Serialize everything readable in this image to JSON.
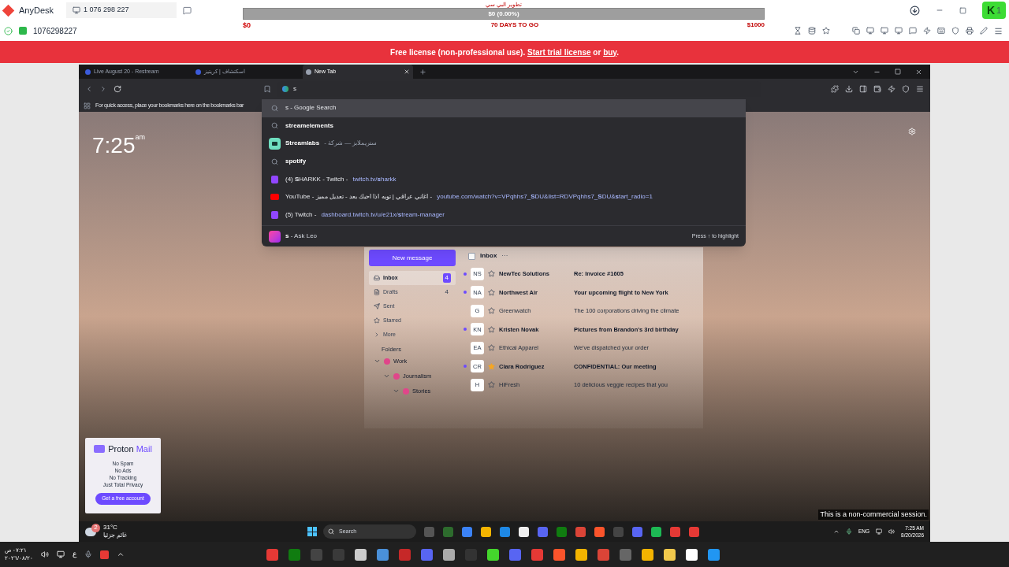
{
  "anydesk": {
    "app_name": "AnyDesk",
    "address": "1 076 298 227",
    "connection_id": "1076298227",
    "logo_letter": "K",
    "logo_badge": "1"
  },
  "goal": {
    "title": "تطوير البي سي",
    "progress": "$0 (0.00%)",
    "level": 0,
    "start": "$0",
    "days": "70 DAYS TO GO",
    "target": "$1000"
  },
  "banner": {
    "prefix": "Free license (non-professional use). ",
    "link_1": "Start trial license",
    "middle": " or ",
    "link_2": "buy",
    "suffix": "."
  },
  "browser": {
    "tabs": [
      {
        "title": "Live August 20 - Restream",
        "selected": false
      },
      {
        "title": "اسكتشاف | كريتيز",
        "selected": false
      },
      {
        "title": "New Tab",
        "selected": true
      }
    ],
    "address": "s",
    "bookmarks_hint": "For quick access, place your bookmarks here on the bookmarks bar",
    "suggestions": [
      {
        "kind": "search",
        "title": "s - Google Search",
        "bold": false,
        "selected": true
      },
      {
        "kind": "search",
        "title": "streamelements",
        "bold": true,
        "selected": false
      },
      {
        "kind": "streamlabs",
        "title": "Streamlabs",
        "bold": true,
        "description": "- ستريملابز — شركة",
        "selected": false
      },
      {
        "kind": "search",
        "title": "spotify",
        "bold": true,
        "selected": false
      },
      {
        "kind": "twitch",
        "title": "(4) **S**HARKK - Twitch -",
        "bold": false,
        "url": "twitch.tv/**s**harkk",
        "selected": false
      },
      {
        "kind": "youtube",
        "title": "YouTube - اغاني عراقي | توبه اذا احبك بعد - تعديل مميز -",
        "bold": false,
        "url": "youtube.com/watch?v=VPqhhs7_**S**DU&list=RDVPqhhs7_**S**DU&**s**tart_radio=1",
        "selected": false
      },
      {
        "kind": "twitch",
        "title": "(5) Twitch -",
        "bold": false,
        "url": "dashboard.twitch.tv/u/e21x/**s**tream-manager",
        "selected": false
      }
    ],
    "ask": {
      "query": "s",
      "label": " - Ask Leo",
      "hint": "Press ↑ to highlight"
    }
  },
  "new_tab": {
    "clock": "7:25",
    "ampm": "am"
  },
  "mail": {
    "new_message": "New message",
    "list_title": "Inbox",
    "select_all_checked": false,
    "more": "···",
    "nav": [
      {
        "kind": "inbox",
        "label": "Inbox",
        "count": "4",
        "selected": true
      },
      {
        "kind": "drafts",
        "label": "Drafts",
        "count": "4",
        "selected": false
      },
      {
        "kind": "sent",
        "label": "Sent",
        "selected": false
      },
      {
        "kind": "starred",
        "label": "Starred",
        "selected": false
      },
      {
        "kind": "more",
        "label": "More",
        "selected": false
      }
    ],
    "folders_label": "Folders",
    "folders": [
      {
        "name": "Work",
        "color": "#e0468a",
        "children": [
          {
            "name": "Journalism",
            "color": "#e0468a",
            "children": [
              {
                "name": "Stories",
                "color": "#e0468a"
              }
            ]
          }
        ]
      }
    ],
    "emails": [
      {
        "initials": "NS",
        "sender": "NewTec Solutions",
        "subject": "Re: Invoice #1605",
        "unread": true,
        "starred": false
      },
      {
        "initials": "NA",
        "sender": "Northwest Air",
        "subject": "Your upcoming flight to New York",
        "unread": true,
        "starred": false
      },
      {
        "initials": "G",
        "sender": "Greenwatch",
        "subject": "The 100 corporations driving the climate",
        "unread": false,
        "starred": false
      },
      {
        "initials": "KN",
        "sender": "Kristen Novak",
        "subject": "Pictures from Brandon's 3rd birthday",
        "unread": true,
        "starred": false
      },
      {
        "initials": "EA",
        "sender": "Ethical Apparel",
        "subject": "We've dispatched your order",
        "unread": false,
        "starred": false
      },
      {
        "initials": "CR",
        "sender": "Clara Rodriguez",
        "subject": "CONFIDENTIAL: Our meeting",
        "unread": true,
        "starred": true
      },
      {
        "initials": "H",
        "sender": "HiFresh",
        "subject": "10 delicious veggie recipes that you",
        "unread": false,
        "starred": false
      }
    ]
  },
  "proton": {
    "brand_1": "Proton",
    "brand_2": "Mail",
    "lines": [
      "No Spam",
      "No Ads",
      "No Tracking",
      "Just Total Privacy"
    ],
    "cta": "Get a free account"
  },
  "notice": "This is a non-commercial session.",
  "remote_taskbar": {
    "temperature": "31°C",
    "condition": "غائم جزئيا",
    "weather_badge": "2",
    "search": "Search",
    "language": "ENG",
    "time": "7:25 AM",
    "date": "8/20/2026"
  },
  "local_taskbar": {
    "time": "٠٧:٢١ ص",
    "date": "٢٠٢٦/٠٨/٢٠",
    "keyboard": "ع"
  }
}
